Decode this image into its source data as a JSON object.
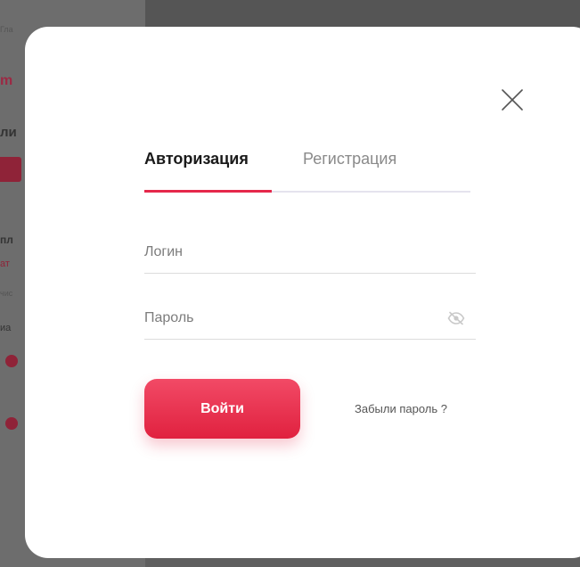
{
  "background": {
    "fragments": [
      "Гла",
      "m",
      "ли",
      "али",
      "пл",
      "ат",
      "чис",
      "иа"
    ]
  },
  "modal": {
    "tabs": [
      {
        "label": "Авторизация",
        "active": true
      },
      {
        "label": "Регистрация",
        "active": false
      }
    ],
    "login_field": {
      "placeholder": "Логин",
      "value": ""
    },
    "password_field": {
      "placeholder": "Пароль",
      "value": ""
    },
    "submit_label": "Войти",
    "forgot_label": "Забыли пароль ?",
    "icons": {
      "close": "close-icon",
      "password_toggle": "eye-off-icon"
    }
  },
  "colors": {
    "accent": "#e5284b",
    "button_gradient_top": "#f24a66",
    "button_gradient_bottom": "#e0213f",
    "tab_track": "#e5e3ee",
    "overlay": "#5f5f5f"
  }
}
